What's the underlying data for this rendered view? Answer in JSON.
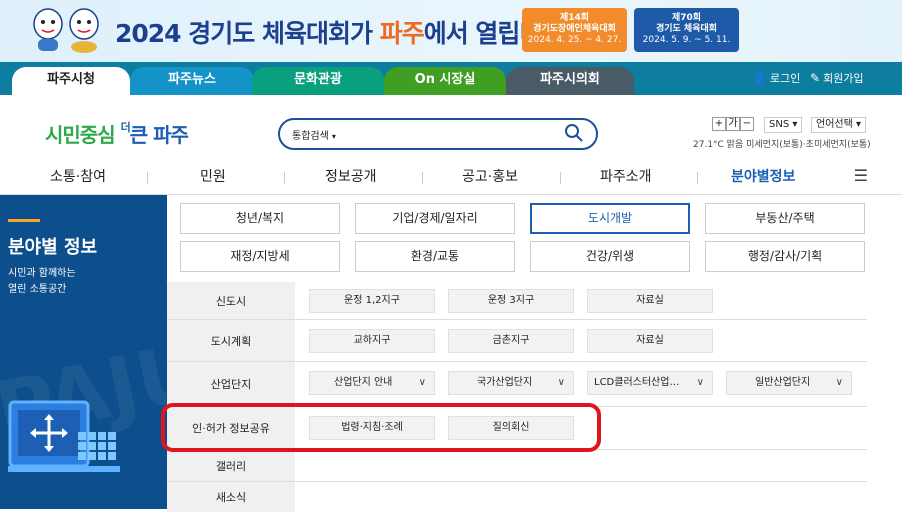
{
  "banner": {
    "title_part1": "2024 경기도 체육대회가 ",
    "title_highlight": "파주",
    "title_part2": "에서 열립니다!",
    "event1": {
      "line1": "제14회",
      "line2": "경기도장애인체육대회",
      "dates": "2024. 4. 25. ~ 4. 27."
    },
    "event2": {
      "line1": "제70회",
      "line2": "경기도 체육대회",
      "dates": "2024. 5. 9. ~ 5. 11."
    }
  },
  "tabs": [
    "파주시청",
    "파주뉴스",
    "문화관광",
    "On 시장실",
    "파주시의회"
  ],
  "util": {
    "login": "로그인",
    "join": "회원가입"
  },
  "logo": {
    "part1": "시민중심",
    "part2": "더",
    "part3": "큰 파주"
  },
  "search": {
    "label": "통합검색"
  },
  "font_size": {
    "plus": "+",
    "text": "가",
    "minus": "−"
  },
  "sns": "SNS",
  "language": "언어선택",
  "weather": "27.1°C 맑음 미세먼지(보통)·초미세먼지(보통)",
  "mainnav": [
    "소통·참여",
    "민원",
    "정보공개",
    "공고·홍보",
    "파주소개",
    "분야별정보"
  ],
  "left": {
    "title": "분야별 정보",
    "desc1": "시민과 함께하는",
    "desc2": "열린 소통공간",
    "watermark": "PAJU"
  },
  "categories": [
    [
      "청년/복지",
      "기업/경제/일자리",
      "도시개발",
      "부동산/주택"
    ],
    [
      "재정/지방세",
      "환경/교통",
      "건강/위생",
      "행정/감사/기획"
    ]
  ],
  "rows": [
    {
      "label": "신도시",
      "items": [
        "운정 1,2지구",
        "운정 3지구",
        "자료실"
      ]
    },
    {
      "label": "도시계획",
      "items": [
        "교하지구",
        "금촌지구",
        "자료실"
      ]
    },
    {
      "label": "산업단지",
      "items": [
        "산업단지 안내",
        "국가산업단지",
        "LCD클러스터산업…",
        "일반산업단지"
      ]
    },
    {
      "label": "인·허가 정보공유",
      "items": [
        "법령·지침·조례",
        "질의회신"
      ]
    },
    {
      "label": "갤러리",
      "items": []
    },
    {
      "label": "새소식",
      "items": []
    }
  ],
  "colors": {
    "primary": "#1a5fb4",
    "left_panel": "#0d4f8c",
    "highlight": "#e0141e"
  }
}
